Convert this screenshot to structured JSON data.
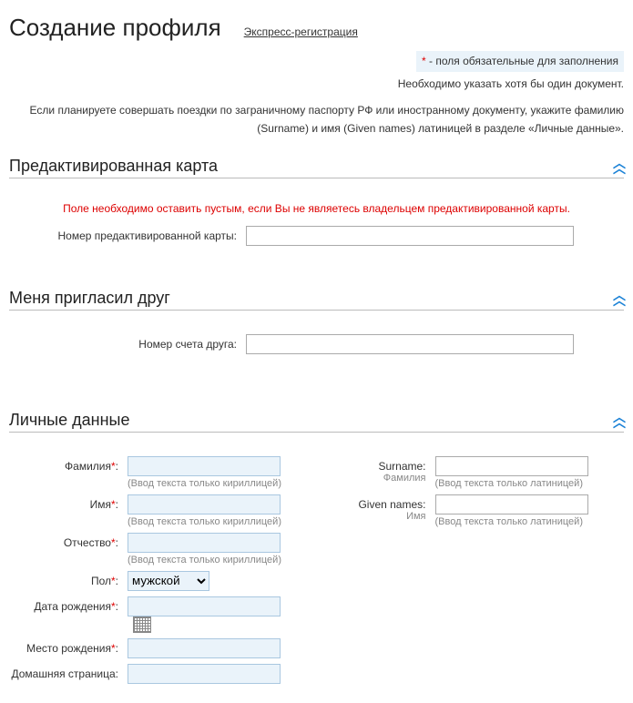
{
  "header": {
    "title": "Создание профиля",
    "express_link": "Экспресс-регистрация"
  },
  "notice": {
    "required_asterisk": "*",
    "required_text": " - поля обязательные для заполнения",
    "at_least_one_doc": "Необходимо указать хотя бы один документ.",
    "latin_hint": "Если планируете совершать поездки по заграничному паспорту РФ или иностранному документу, укажите фамилию (Surname) и имя (Given names) латиницей в разделе «Личные данные»."
  },
  "section_preactivated": {
    "title": "Предактивированная карта",
    "warning": "Поле необходимо оставить пустым, если Вы не являетесь владельцем предактивированной карты.",
    "card_label": "Номер предактивированной карты:"
  },
  "section_friend": {
    "title": "Меня пригласил друг",
    "account_label": "Номер счета друга:"
  },
  "section_personal": {
    "title": "Личные данные",
    "surname_ru_label": "Фамилия",
    "surname_ru_hint": "(Ввод текста только кириллицей)",
    "surname_en_label": "Surname:",
    "surname_en_sub": "Фамилия",
    "surname_en_hint": "(Ввод текста только латиницей)",
    "name_ru_label": "Имя",
    "name_ru_hint": "(Ввод текста только кириллицей)",
    "name_en_label": "Given names:",
    "name_en_sub": "Имя",
    "name_en_hint": "(Ввод текста только латиницей)",
    "patronymic_label": "Отчество",
    "patronymic_hint": "(Ввод текста только кириллицей)",
    "gender_label": "Пол",
    "gender_value": "мужской",
    "dob_label": "Дата рождения",
    "pob_label": "Место рождения",
    "homepage_label": "Домашняя страница"
  },
  "marks": {
    "ast": "*",
    "colon": ":"
  }
}
